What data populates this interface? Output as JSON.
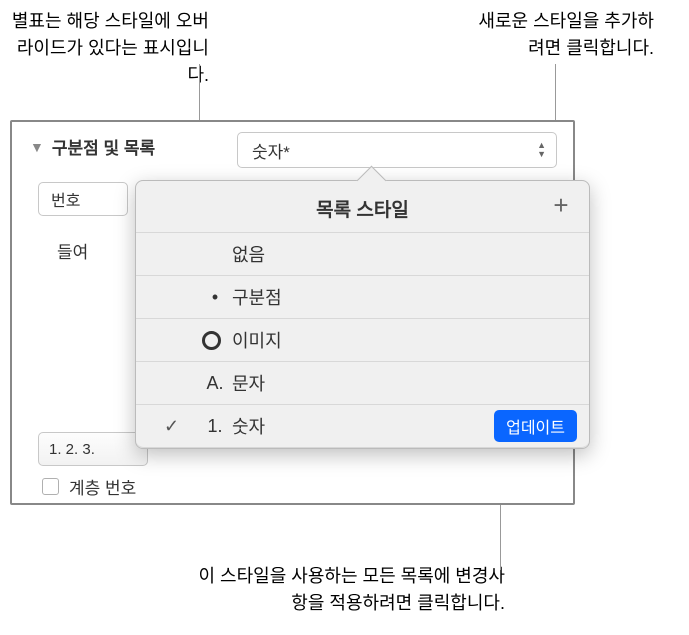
{
  "callouts": {
    "asterisk": "별표는 해당 스타일에 오버라이드가 있다는 표시입니다.",
    "addNew": "새로운 스타일을 추가하려면 클릭합니다.",
    "update": "이 스타일을 사용하는 모든 목록에 변경사항을 적용하려면 클릭합니다."
  },
  "panel": {
    "sectionTitle": "구분점 및 목록",
    "styleDropdown": "숫자*",
    "subDropdown": "번호",
    "indentLabel": "들여",
    "formatButton": "1. 2. 3.",
    "checkboxLabel": "계층 번호"
  },
  "popover": {
    "title": "목록 스타일",
    "items": {
      "none": "없음",
      "bullet": "구분점",
      "image": "이미지",
      "letter": "문자",
      "letterPrefix": "A.",
      "number": "숫자",
      "numberPrefix": "1."
    },
    "updateButton": "업데이트"
  }
}
